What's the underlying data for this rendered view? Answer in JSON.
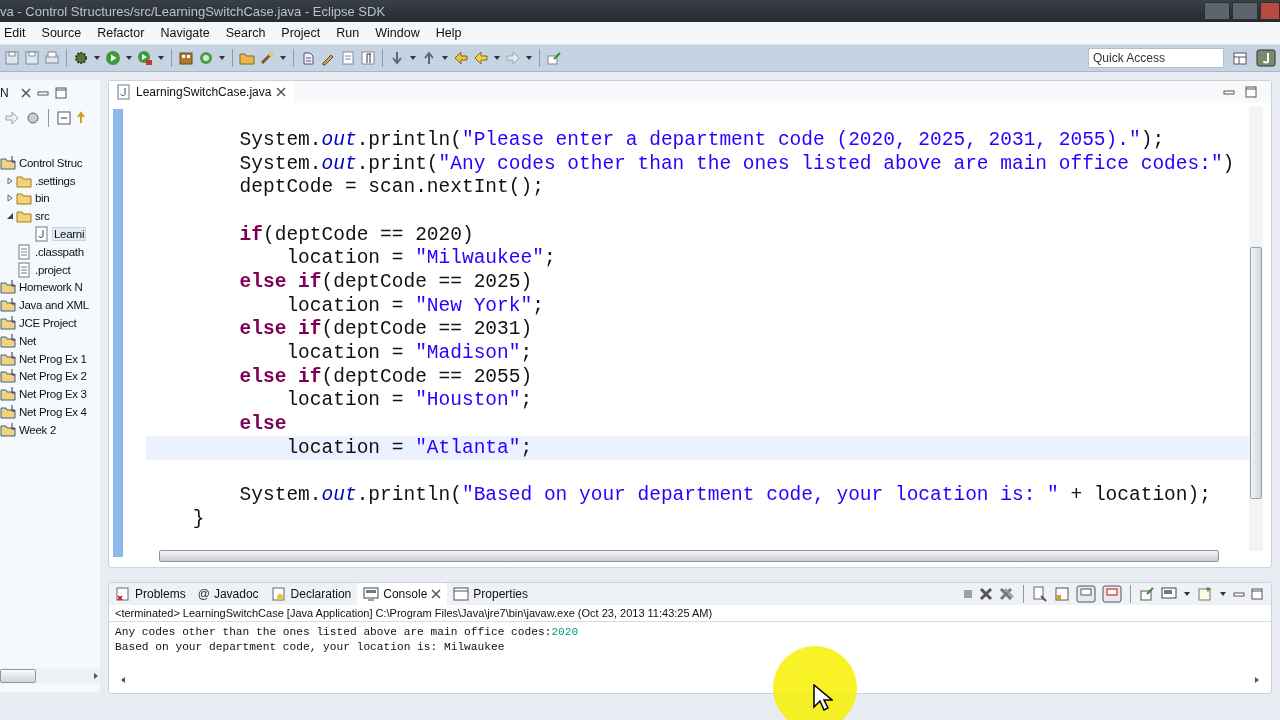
{
  "window": {
    "title": "va - Control Structures/src/LearningSwitchCase.java - Eclipse SDK"
  },
  "menu": [
    "Edit",
    "Source",
    "Refactor",
    "Navigate",
    "Search",
    "Project",
    "Run",
    "Window",
    "Help"
  ],
  "quick_access": {
    "placeholder": "Quick Access"
  },
  "explorer": {
    "tab": "N",
    "tree": [
      {
        "label": "Control Struc",
        "kind": "project",
        "selected": false,
        "children": [
          {
            "label": ".settings",
            "kind": "folder",
            "expanded": false,
            "selected": false
          },
          {
            "label": "bin",
            "kind": "folder",
            "expanded": false,
            "selected": false
          },
          {
            "label": "src",
            "kind": "folder",
            "expanded": true,
            "selected": false,
            "children": [
              {
                "label": "Learni",
                "kind": "java",
                "selected": true
              }
            ]
          },
          {
            "label": ".classpath",
            "kind": "file",
            "selected": false
          },
          {
            "label": ".project",
            "kind": "file",
            "selected": false
          }
        ]
      },
      {
        "label": "Homework N",
        "kind": "project",
        "selected": false
      },
      {
        "label": "Java and XML",
        "kind": "project",
        "selected": false
      },
      {
        "label": "JCE Project",
        "kind": "project",
        "selected": false
      },
      {
        "label": "Net",
        "kind": "project",
        "selected": false
      },
      {
        "label": "Net Prog Ex 1",
        "kind": "project",
        "selected": false
      },
      {
        "label": "Net Prog Ex 2",
        "kind": "project",
        "selected": false
      },
      {
        "label": "Net Prog Ex 3",
        "kind": "project",
        "selected": false
      },
      {
        "label": "Net Prog Ex 4",
        "kind": "project",
        "selected": false
      },
      {
        "label": "Week 2",
        "kind": "project",
        "selected": false
      }
    ]
  },
  "editor": {
    "tab": {
      "label": "LearningSwitchCase.java",
      "selected": true
    },
    "lines": [
      {
        "kind": "code",
        "current": false,
        "tokens": [
          {
            "kind": "plain",
            "text": "        System."
          },
          {
            "kind": "field",
            "text": "out"
          },
          {
            "kind": "plain",
            "text": ".println("
          },
          {
            "kind": "string",
            "text": "\"Please enter a department code (2020, 2025, 2031, 2055).\""
          },
          {
            "kind": "plain",
            "text": ");"
          }
        ]
      },
      {
        "kind": "code",
        "current": false,
        "tokens": [
          {
            "kind": "plain",
            "text": "        System."
          },
          {
            "kind": "field",
            "text": "out"
          },
          {
            "kind": "plain",
            "text": ".print("
          },
          {
            "kind": "string",
            "text": "\"Any codes other than the ones listed above are main office codes:\""
          },
          {
            "kind": "plain",
            "text": ")"
          }
        ]
      },
      {
        "kind": "code",
        "current": false,
        "tokens": [
          {
            "kind": "plain",
            "text": "        deptCode = scan.nextInt();"
          }
        ]
      },
      {
        "kind": "blank"
      },
      {
        "kind": "code",
        "current": false,
        "tokens": [
          {
            "kind": "keyword",
            "text": "        if"
          },
          {
            "kind": "plain",
            "text": "(deptCode == 2020)"
          }
        ]
      },
      {
        "kind": "code",
        "current": false,
        "tokens": [
          {
            "kind": "plain",
            "text": "            location = "
          },
          {
            "kind": "string",
            "text": "\"Milwaukee\""
          },
          {
            "kind": "plain",
            "text": ";"
          }
        ]
      },
      {
        "kind": "code",
        "current": false,
        "tokens": [
          {
            "kind": "keyword",
            "text": "        else if"
          },
          {
            "kind": "plain",
            "text": "(deptCode == 2025)"
          }
        ]
      },
      {
        "kind": "code",
        "current": false,
        "tokens": [
          {
            "kind": "plain",
            "text": "            location = "
          },
          {
            "kind": "string",
            "text": "\"New York\""
          },
          {
            "kind": "plain",
            "text": ";"
          }
        ]
      },
      {
        "kind": "code",
        "current": false,
        "tokens": [
          {
            "kind": "keyword",
            "text": "        else if"
          },
          {
            "kind": "plain",
            "text": "(deptCode == 2031)"
          }
        ]
      },
      {
        "kind": "code",
        "current": false,
        "tokens": [
          {
            "kind": "plain",
            "text": "            location = "
          },
          {
            "kind": "string",
            "text": "\"Madison\""
          },
          {
            "kind": "plain",
            "text": ";"
          }
        ]
      },
      {
        "kind": "code",
        "current": false,
        "tokens": [
          {
            "kind": "keyword",
            "text": "        else if"
          },
          {
            "kind": "plain",
            "text": "(deptCode == 2055)"
          }
        ]
      },
      {
        "kind": "code",
        "current": false,
        "tokens": [
          {
            "kind": "plain",
            "text": "            location = "
          },
          {
            "kind": "string",
            "text": "\"Houston\""
          },
          {
            "kind": "plain",
            "text": ";"
          }
        ]
      },
      {
        "kind": "code",
        "current": false,
        "tokens": [
          {
            "kind": "keyword",
            "text": "        else"
          }
        ]
      },
      {
        "kind": "code",
        "current": true,
        "tokens": [
          {
            "kind": "plain",
            "text": "            location = "
          },
          {
            "kind": "string",
            "text": "\"Atlanta\""
          },
          {
            "kind": "plain",
            "text": ";"
          }
        ]
      },
      {
        "kind": "blank"
      },
      {
        "kind": "code",
        "current": false,
        "tokens": [
          {
            "kind": "plain",
            "text": "        System."
          },
          {
            "kind": "field",
            "text": "out"
          },
          {
            "kind": "plain",
            "text": ".println("
          },
          {
            "kind": "string",
            "text": "\"Based on your department code, your location is: \""
          },
          {
            "kind": "plain",
            "text": " + location);"
          }
        ]
      },
      {
        "kind": "code",
        "current": false,
        "tokens": [
          {
            "kind": "plain",
            "text": "    }"
          }
        ]
      }
    ]
  },
  "console": {
    "tabs": [
      {
        "label": "Problems",
        "kind": "problems",
        "selected": false
      },
      {
        "label": "Javadoc",
        "kind": "javadoc",
        "glyph": "@",
        "selected": false
      },
      {
        "label": "Declaration",
        "kind": "declaration",
        "selected": false
      },
      {
        "label": "Console",
        "kind": "console",
        "selected": true
      },
      {
        "label": "Properties",
        "kind": "properties",
        "selected": false
      }
    ],
    "header": "<terminated> LearningSwitchCase [Java Application] C:\\Program Files\\Java\\jre7\\bin\\javaw.exe (Oct 23, 2013 11:43:25 AM)",
    "output": [
      {
        "segments": [
          {
            "kind": "output",
            "text": "Any codes other than the ones listed above are main office codes:"
          },
          {
            "kind": "input",
            "text": "2020"
          }
        ]
      },
      {
        "segments": [
          {
            "kind": "output",
            "text": "Based on your department code, your location is: Milwaukee"
          }
        ]
      }
    ]
  }
}
